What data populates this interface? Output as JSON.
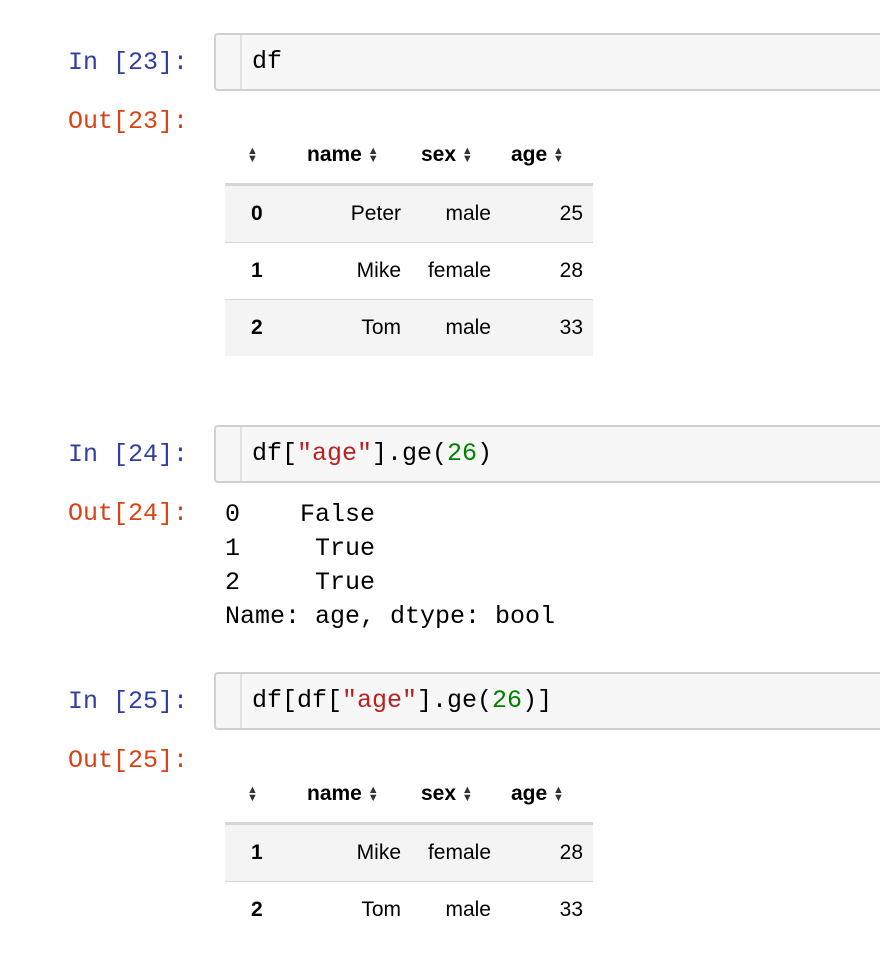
{
  "cells": [
    {
      "in_prompt": "In [23]:",
      "out_prompt": "Out[23]:",
      "code": "df",
      "table": {
        "columns": [
          "name",
          "sex",
          "age"
        ],
        "rows": [
          {
            "index": "0",
            "name": "Peter",
            "sex": "male",
            "age": "25"
          },
          {
            "index": "1",
            "name": "Mike",
            "sex": "female",
            "age": "28"
          },
          {
            "index": "2",
            "name": "Tom",
            "sex": "male",
            "age": "33"
          }
        ]
      }
    },
    {
      "in_prompt": "In [24]:",
      "out_prompt": "Out[24]:",
      "code_parts": [
        "df[",
        "\"age\"",
        "].ge(",
        "26",
        ")"
      ],
      "output_lines": [
        "0    False",
        "1     True",
        "2     True",
        "Name: age, dtype: bool"
      ]
    },
    {
      "in_prompt": "In [25]:",
      "out_prompt": "Out[25]:",
      "code_parts": [
        "df[df[",
        "\"age\"",
        "].ge(",
        "26",
        ")]"
      ],
      "table": {
        "columns": [
          "name",
          "sex",
          "age"
        ],
        "rows": [
          {
            "index": "1",
            "name": "Mike",
            "sex": "female",
            "age": "28"
          },
          {
            "index": "2",
            "name": "Tom",
            "sex": "male",
            "age": "33"
          }
        ]
      }
    }
  ],
  "icons": {
    "sort": "sort-icon"
  },
  "colors": {
    "in_prompt": "#303f9f",
    "out_prompt": "#d84315",
    "string": "#ba2121",
    "number": "#008000"
  }
}
